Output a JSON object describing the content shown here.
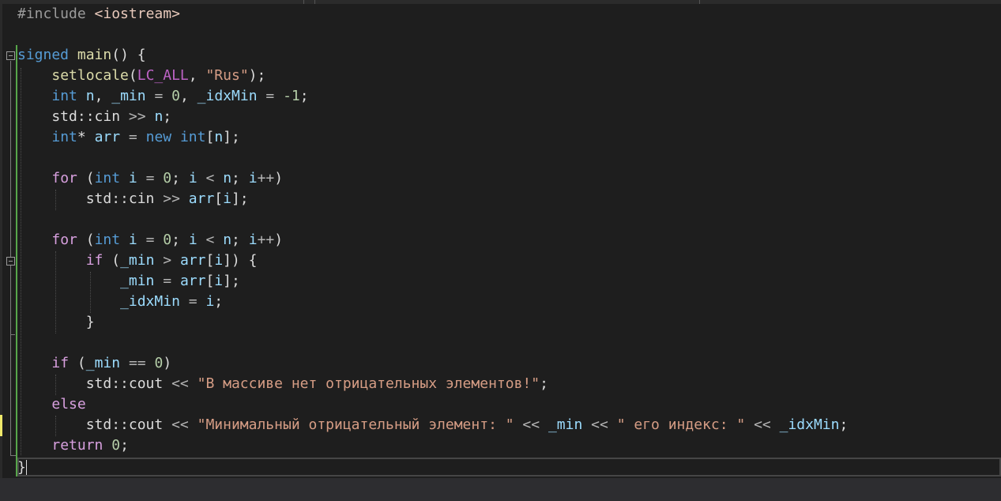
{
  "editor": {
    "language": "C++",
    "lines": [
      "#include <iostream>",
      "",
      "signed main() {",
      "    setlocale(LC_ALL, \"Rus\");",
      "    int n, _min = 0, _idxMin = -1;",
      "    std::cin >> n;",
      "    int* arr = new int[n];",
      "",
      "    for (int i = 0; i < n; i++)",
      "        std::cin >> arr[i];",
      "",
      "    for (int i = 0; i < n; i++)",
      "        if (_min > arr[i]) {",
      "            _min = arr[i];",
      "            _idxMin = i;",
      "        }",
      "",
      "    if (_min == 0)",
      "        std::cout << \"В массиве нет отрицательных элементов!\";",
      "    else",
      "        std::cout << \"Минимальный отрицательный элемент: \" << _min << \" его индекс: \" << _idxMin;",
      "    return 0;",
      "}"
    ],
    "colors": {
      "background": "#1e1e1e",
      "keyword": "#569cd6",
      "control": "#d8a0df",
      "function": "#dcdcaa",
      "variable": "#9cdcfe",
      "string": "#d69d85",
      "number": "#b5cea8",
      "macro": "#bd63c5",
      "preprocessor": "#9b9b9b",
      "default_text": "#dcdcdc"
    },
    "icons": [
      "fold-collapse-icon"
    ]
  }
}
